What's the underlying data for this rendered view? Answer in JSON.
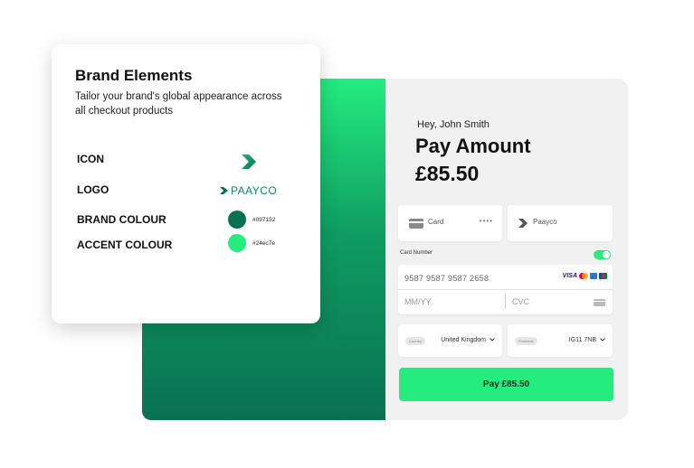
{
  "colors": {
    "brand": "#097152",
    "accent": "#24ec7e"
  },
  "brand_elements": {
    "title": "Brand Elements",
    "description": "Tailor your brand's global appearance across all checkout products",
    "rows": {
      "icon": {
        "label": "ICON",
        "icon": "chevron-right-icon"
      },
      "logo": {
        "label": "LOGO",
        "text": "PAAYCO"
      },
      "brand_colour": {
        "label": "BRAND COLOUR",
        "value": "#097152"
      },
      "accent_colour": {
        "label": "ACCENT COLOUR",
        "value": "#24ec7e"
      }
    }
  },
  "checkout": {
    "greeting": "Hey, John Smith",
    "title": "Pay Amount",
    "amount": "£85.50",
    "methods": [
      {
        "label": "Card",
        "masked": "••••",
        "icon": "credit-card-icon"
      },
      {
        "label": "Paayco",
        "icon": "paayco-chevron-icon"
      }
    ],
    "card_number_label": "Card Number",
    "card_number": "9587 9587 9587 2658",
    "card_brands": [
      "VISA",
      "mastercard-icon",
      "amex-icon",
      "jcb-icon"
    ],
    "expiry_placeholder": "MM/YY",
    "cvc_placeholder": "CVC",
    "country": {
      "label": "Country",
      "value": "United Kingdom"
    },
    "postcode": {
      "label": "Postcode",
      "value": "IG11 7NB"
    },
    "pay_button": "Pay £85.50"
  }
}
